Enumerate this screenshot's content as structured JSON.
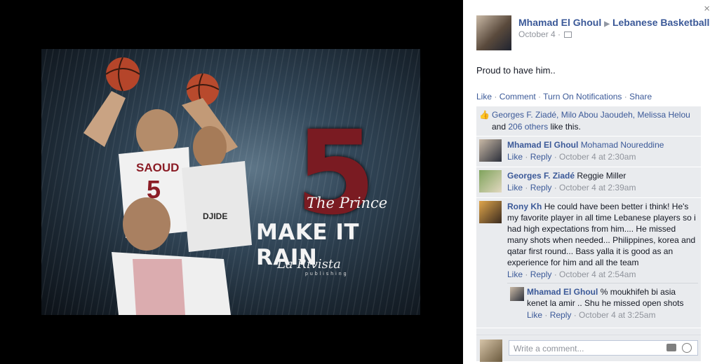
{
  "photo": {
    "big_number": "5",
    "subtitle": "The Prince",
    "headline": "MAKE IT RAIN",
    "brand": "La Rivista",
    "brand_sub": "publishing",
    "jersey_name": "SAOUD",
    "jersey_number": "5",
    "sponsor": "DJIDE"
  },
  "post": {
    "close_label": "×",
    "author": "Mhamad El Ghoul",
    "target": "Lebanese Basketball",
    "date": "October 4",
    "audience_icon": "friends-icon",
    "text": "Proud to have him..",
    "actions": [
      "Like",
      "Comment",
      "Turn On Notifications",
      "Share"
    ]
  },
  "likes": {
    "names": "Georges F. Ziadé, Milo Abou Jaoudeh, Melissa Helou",
    "and": "and",
    "others": "206 others",
    "suffix": "like this."
  },
  "comments": [
    {
      "author": "Mhamad El Ghoul",
      "text": "Mohamad Noureddine",
      "like": "Like",
      "reply": "Reply",
      "time": "October 4 at 2:30am"
    },
    {
      "author": "Georges F. Ziadé",
      "text": "Reggie Miller",
      "like": "Like",
      "reply": "Reply",
      "time": "October 4 at 2:39am"
    },
    {
      "author": "Rony Kh",
      "text": "He could have been better i think! He's my favorite player in all time Lebanese players so i had high expectations from him.... He missed many shots when needed... Philippines, korea and qatar first round... Bass yalla it is good as an experience for him and all the team",
      "like": "Like",
      "reply": "Reply",
      "time": "October 4 at 2:54am"
    }
  ],
  "reply": {
    "author": "Mhamad El Ghoul",
    "text": "% moukhifeh bi asia kenet la amir .. Shu he missed open shots",
    "like": "Like",
    "reply": "Reply",
    "time": "October 4 at 3:25am"
  },
  "composer": {
    "placeholder": "Write a comment..."
  },
  "colors": {
    "link": "#3b5998",
    "panel": "#e9ebee",
    "meta": "#90949c"
  }
}
